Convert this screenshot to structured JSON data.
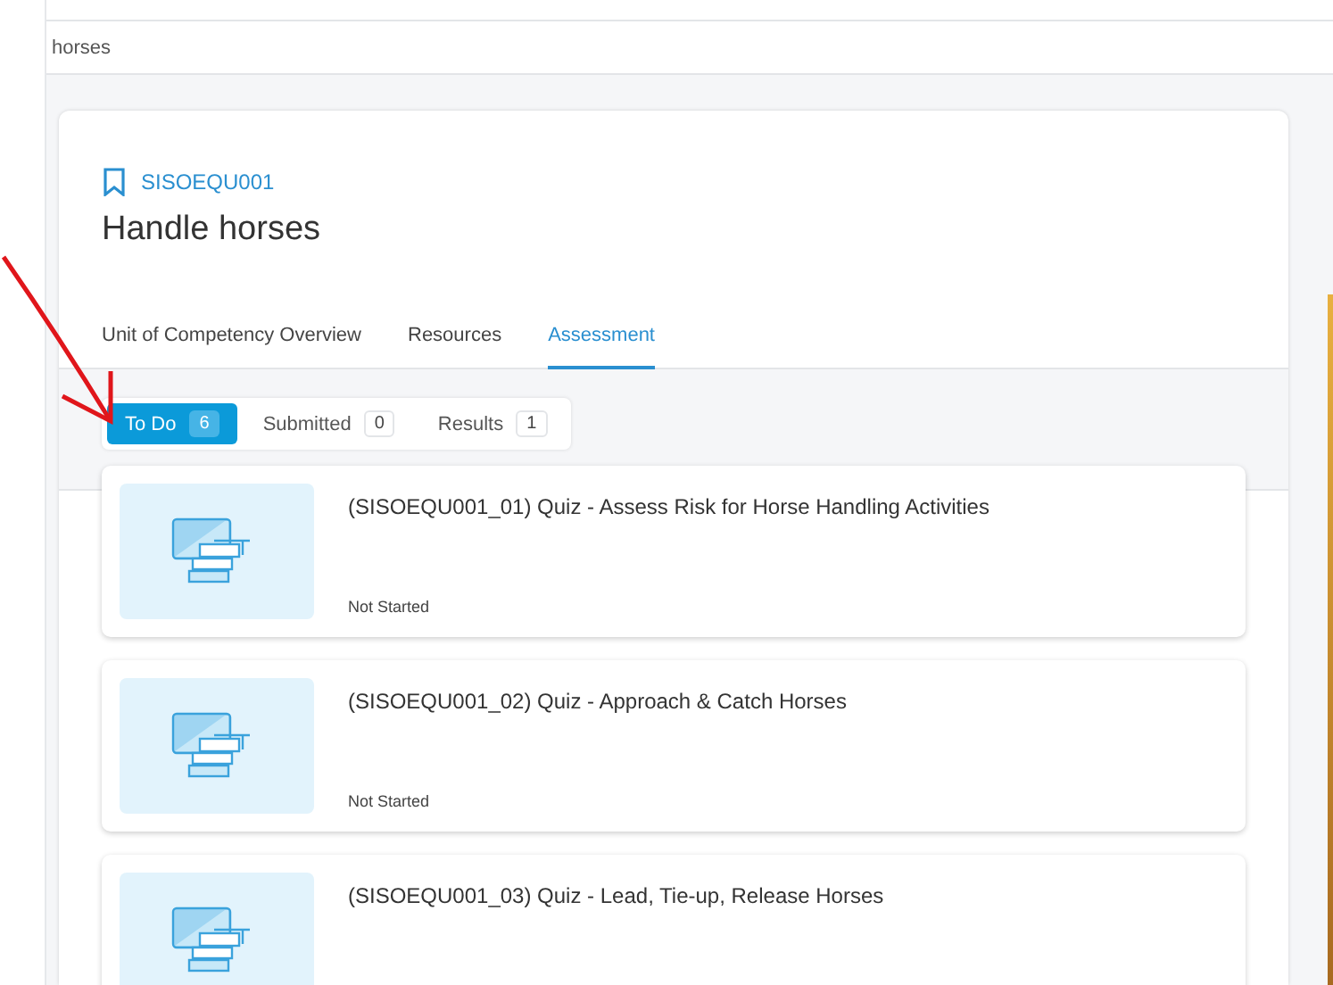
{
  "breadcrumb": "horses",
  "unit": {
    "code": "SISOEQU001",
    "title": "Handle horses"
  },
  "tabs": [
    {
      "label": "Unit of Competency Overview",
      "selected": false
    },
    {
      "label": "Resources",
      "selected": false
    },
    {
      "label": "Assessment",
      "selected": true
    }
  ],
  "filters": [
    {
      "label": "To Do",
      "count": "6",
      "selected": true
    },
    {
      "label": "Submitted",
      "count": "0",
      "selected": false
    },
    {
      "label": "Results",
      "count": "1",
      "selected": false
    }
  ],
  "assessments": [
    {
      "title": "(SISOEQU001_01) Quiz - Assess Risk for Horse Handling Activities",
      "status": "Not Started"
    },
    {
      "title": "(SISOEQU001_02) Quiz - Approach & Catch Horses",
      "status": "Not Started"
    },
    {
      "title": "(SISOEQU001_03) Quiz - Lead, Tie-up, Release Horses"
    }
  ]
}
